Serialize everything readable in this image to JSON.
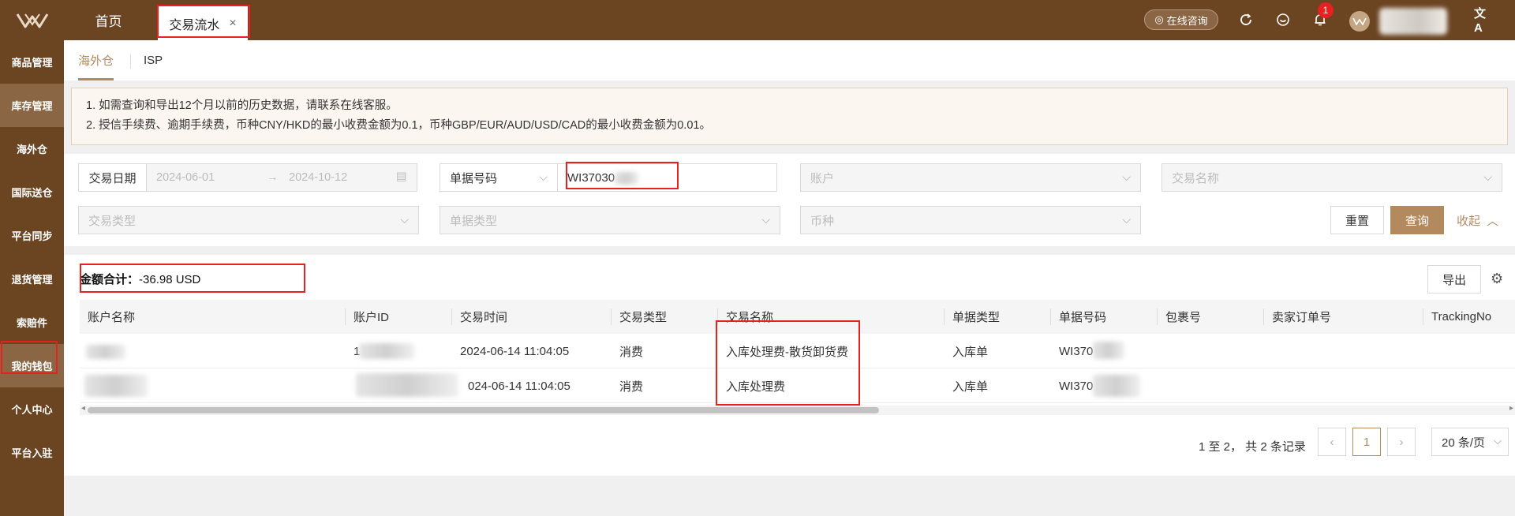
{
  "header": {
    "tabs": [
      {
        "label": "首页",
        "active": false
      },
      {
        "label": "交易流水",
        "active": true
      }
    ],
    "consult_label": "在线咨询",
    "notification_count": "1",
    "brand_color": "#6b4422",
    "accent_color": "#b38a5e"
  },
  "sidebar": {
    "items": [
      {
        "label": "商品管理"
      },
      {
        "label": "库存管理"
      },
      {
        "label": "海外仓"
      },
      {
        "label": "国际送仓"
      },
      {
        "label": "平台同步"
      },
      {
        "label": "退货管理"
      },
      {
        "label": "索赔件"
      },
      {
        "label": "我的钱包"
      },
      {
        "label": "个人中心"
      },
      {
        "label": "平台入驻"
      }
    ]
  },
  "subtabs": [
    {
      "label": "海外仓",
      "active": true
    },
    {
      "label": "ISP",
      "active": false
    }
  ],
  "notice": {
    "lines": [
      "1. 如需查询和导出12个月以前的历史数据，请联系在线客服。",
      "2. 授信手续费、逾期手续费，币种CNY/HKD的最小收费金额为0.1，币种GBP/EUR/AUD/USD/CAD的最小收费金额为0.01。"
    ]
  },
  "filters": {
    "date_label": "交易日期",
    "date_start": "2024-06-01",
    "date_end": "2024-10-12",
    "doc_no_type": "单据号码",
    "doc_no_value": "WI37030",
    "account_placeholder": "账户",
    "tx_name_placeholder": "交易名称",
    "tx_type_placeholder": "交易类型",
    "doc_type_placeholder": "单据类型",
    "currency_placeholder": "币种",
    "reset_label": "重置",
    "search_label": "查询",
    "collapse_label": "收起"
  },
  "summary": {
    "label": "金额合计：",
    "value": "-36.98 USD"
  },
  "export_label": "导出",
  "table": {
    "columns": [
      "账户名称",
      "账户ID",
      "交易时间",
      "交易类型",
      "交易名称",
      "单据类型",
      "单据号码",
      "包裹号",
      "卖家订单号",
      "TrackingNo"
    ],
    "rows": [
      {
        "account_id": "1",
        "time": "2024-06-14 11:04:05",
        "type": "消费",
        "name": "入库处理费-散货卸货费",
        "doc_type": "入库单",
        "doc_no": "WI370"
      },
      {
        "account_id": "",
        "time": "024-06-14 11:04:05",
        "type": "消费",
        "name": "入库处理费",
        "doc_type": "入库单",
        "doc_no": "WI370"
      }
    ]
  },
  "pagination": {
    "summary": "1 至 2， 共 2 条记录",
    "current_page": "1",
    "page_size": "20 条/页"
  }
}
